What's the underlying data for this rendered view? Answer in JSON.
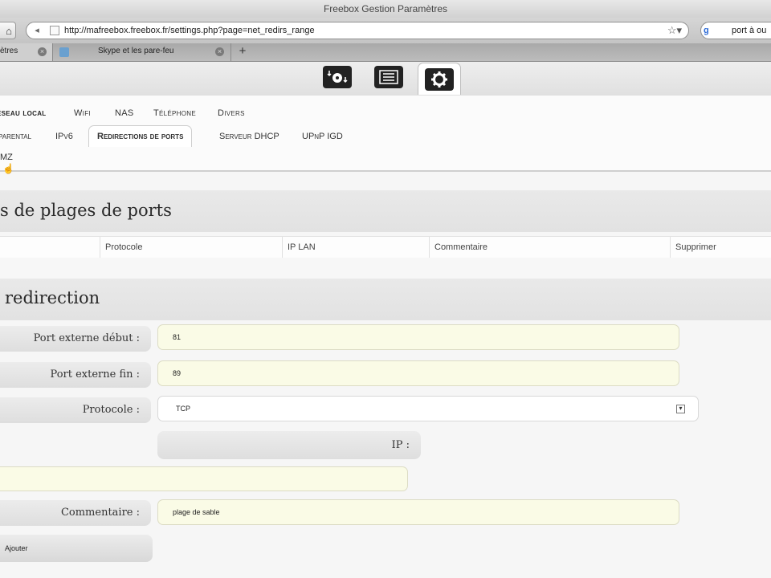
{
  "window": {
    "title": "Freebox Gestion Paramètres"
  },
  "browser": {
    "url": "http://mafreebox.freebox.fr/settings.php?page=net_redirs_range",
    "search_value": "port à ou",
    "search_engine": "g",
    "tabs": [
      {
        "label": "ètres",
        "active": true
      },
      {
        "label": "Skype et les pare-feu",
        "active": false
      }
    ],
    "new_tab": "+"
  },
  "app": {
    "header_icons": [
      "download-disk-icon",
      "list-icon",
      "gear-icon"
    ],
    "active_header_icon": "gear-icon",
    "main_menu": [
      {
        "label": "éseau local",
        "active": true
      },
      {
        "label": "Wifi",
        "active": false
      },
      {
        "label": "NAS",
        "active": false
      },
      {
        "label": "Téléphone",
        "active": false
      },
      {
        "label": "Divers",
        "active": false
      }
    ],
    "sub_menu": [
      {
        "label": "parental",
        "active": false
      },
      {
        "label": "IPv6",
        "active": false
      },
      {
        "label": "Redirections de ports",
        "active": true
      },
      {
        "label": "Serveur DHCP",
        "active": false
      },
      {
        "label": "UPnP IGD",
        "active": false
      }
    ],
    "dmz_link": "MZ"
  },
  "ranges_section": {
    "title": "s de plages de ports",
    "columns": [
      "Protocole",
      "IP LAN",
      "Commentaire",
      "Supprimer"
    ]
  },
  "form_section": {
    "title": "redirection",
    "fields": {
      "port_start": {
        "label": "Port externe début :",
        "value": "81"
      },
      "port_end": {
        "label": "Port externe fin :",
        "value": "89"
      },
      "protocol": {
        "label": "Protocole :",
        "value": "TCP"
      },
      "ip": {
        "label": "IP :",
        "value": ""
      },
      "comment": {
        "label": "Commentaire :",
        "value": "plage de sable"
      }
    },
    "submit_label": "Ajouter"
  }
}
